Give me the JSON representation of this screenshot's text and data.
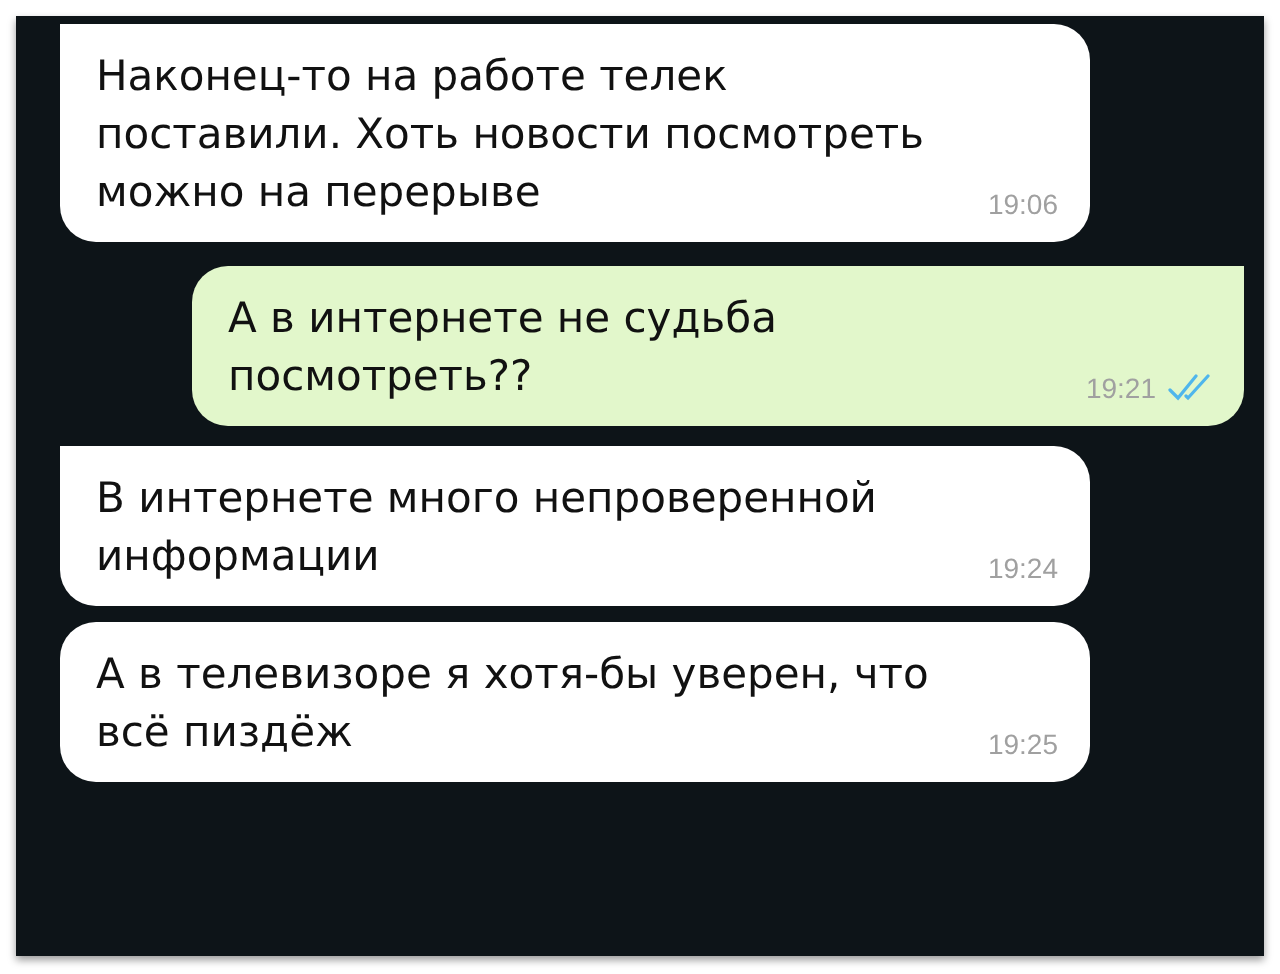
{
  "messages": [
    {
      "kind": "in",
      "tail": true,
      "text": "Наконец-то на работе телек поставили. Хоть новости посмотреть можно на перерыве",
      "time": "19:06"
    },
    {
      "kind": "out",
      "tail": true,
      "text": "А в интернете не судьба посмотреть??",
      "time": "19:21",
      "read": true
    },
    {
      "kind": "in",
      "tail": true,
      "text": "В интернете много непроверенной информации",
      "time": "19:24"
    },
    {
      "kind": "in",
      "tail": false,
      "text": "А в телевизоре я хотя-бы уверен, что всё пиздёж",
      "time": "19:25"
    }
  ]
}
